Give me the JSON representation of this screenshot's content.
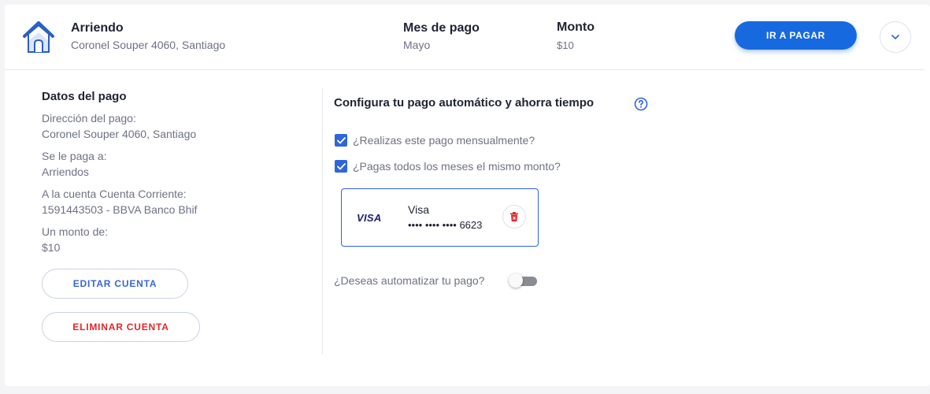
{
  "header": {
    "icon": "house-icon",
    "title": "Arriendo",
    "address": "Coronel Souper 4060, Santiago",
    "month_label": "Mes de pago",
    "month_value": "Mayo",
    "amount_label": "Monto",
    "amount_value": "$10",
    "pay_button": "IR A PAGAR",
    "expand_icon": "chevron-down-icon"
  },
  "details": {
    "title": "Datos del pago",
    "items": [
      {
        "label": "Dirección del pago:",
        "value": "Coronel Souper 4060, Santiago"
      },
      {
        "label": "Se le paga a:",
        "value": "Arriendos"
      },
      {
        "label": "A la cuenta Cuenta Corriente:",
        "value": "1591443503 - BBVA Banco Bhif"
      },
      {
        "label": "Un monto de:",
        "value": "$10"
      }
    ],
    "edit_button": "EDITAR CUENTA",
    "delete_button": "ELIMINAR CUENTA"
  },
  "automatic": {
    "title": "Configura tu pago automático y ahorra tiempo",
    "help_icon": "question-circle-icon",
    "questions": [
      {
        "label": "¿Realizas este pago mensualmente?",
        "checked": true
      },
      {
        "label": "¿Pagas todos los meses el mismo monto?",
        "checked": true
      }
    ],
    "card": {
      "logo": "VISA",
      "brand": "Visa",
      "number": "•••• •••• •••• 6623",
      "delete_icon": "trash-icon"
    },
    "toggle_label": "¿Deseas automatizar tu pago?",
    "toggle_on": false
  },
  "colors": {
    "primary": "#1769e0",
    "checkbox": "#2f64dc",
    "danger": "#e3262a",
    "house": "#2a5fc4"
  }
}
